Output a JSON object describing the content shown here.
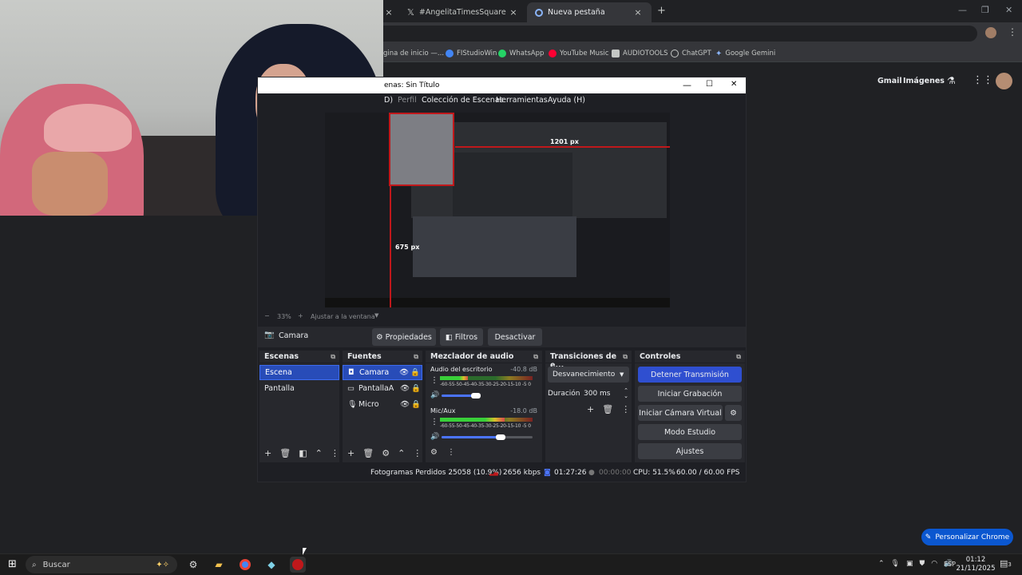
{
  "chrome": {
    "tabs": [
      {
        "title": "#AngelitaTimesSquare - Buscar",
        "close": "×"
      },
      {
        "title": "Nueva pestaña",
        "close": "×"
      }
    ],
    "new_tab": "+",
    "window_controls": {
      "minimize": "—",
      "maximize": "❐",
      "close": "✕"
    },
    "bookmarks": [
      {
        "label": "gina de inicio —...",
        "color": "#8ab4f8"
      },
      {
        "label": "FIStudioWin",
        "color": "#4285f4"
      },
      {
        "label": "WhatsApp",
        "color": "#25d366"
      },
      {
        "label": "YouTube Music",
        "color": "#ff0033"
      },
      {
        "label": "AUDIOTOOLS",
        "color": "#c4c7c5"
      },
      {
        "label": "ChatGPT",
        "color": "#c4c7c5"
      },
      {
        "label": "Google Gemini",
        "color": "#8ab4f8"
      }
    ],
    "google_links": {
      "gmail": "Gmail",
      "images": "Imágenes"
    },
    "personalize": "Personalizar Chrome"
  },
  "obs": {
    "title": "enas: Sin Título",
    "menu": [
      "D)",
      "Perfil",
      "Colección de Escenas",
      "Herramientas",
      "Ayuda (H)"
    ],
    "preview_labels": {
      "width": "1201 px",
      "height": "675 px"
    },
    "zoom": {
      "minus": "−",
      "value": "33%",
      "plus": "+",
      "fit": "Ajustar a la ventana"
    },
    "source_bar": {
      "source": "Camara",
      "properties": "Propiedades",
      "filters": "Filtros",
      "deactivate": "Desactivar"
    },
    "scenes": {
      "title": "Escenas",
      "items": [
        "Escena",
        "Pantalla"
      ]
    },
    "sources": {
      "title": "Fuentes",
      "items": [
        "Camara",
        "PantallaA",
        "Micro"
      ]
    },
    "mixer": {
      "title": "Mezclador de audio",
      "channels": [
        {
          "name": "Audio del escritorio",
          "db": "-40.8 dB",
          "level": 0.3,
          "volume": 0.38
        },
        {
          "name": "Mic/Aux",
          "db": "-18.0 dB",
          "level": 0.7,
          "volume": 0.65
        }
      ],
      "scale": "-60-55-50-45-40-35-30-25-20-15-10 -5 0"
    },
    "transitions": {
      "title": "Transiciones de e...",
      "selected": "Desvanecimiento",
      "duration_label": "Duración",
      "duration_value": "300 ms"
    },
    "controls": {
      "title": "Controles",
      "stop_stream": "Detener Transmisión",
      "start_recording": "Iniciar Grabación",
      "virtual_cam": "Iniciar Cámara Virtual",
      "studio_mode": "Modo Estudio",
      "settings": "Ajustes"
    },
    "status": {
      "dropped": "Fotogramas Perdidos 25058 (10.9%)",
      "kbps": "2656 kbps",
      "stream_time": "01:27:26",
      "rec_time": "00:00:00",
      "cpu": "CPU: 51.5%",
      "fps": "60.00 / 60.00 FPS"
    }
  },
  "taskbar": {
    "search": "Buscar",
    "lang": "ESP",
    "time": "01:12",
    "date": "21/11/2025",
    "notifications": "3"
  }
}
